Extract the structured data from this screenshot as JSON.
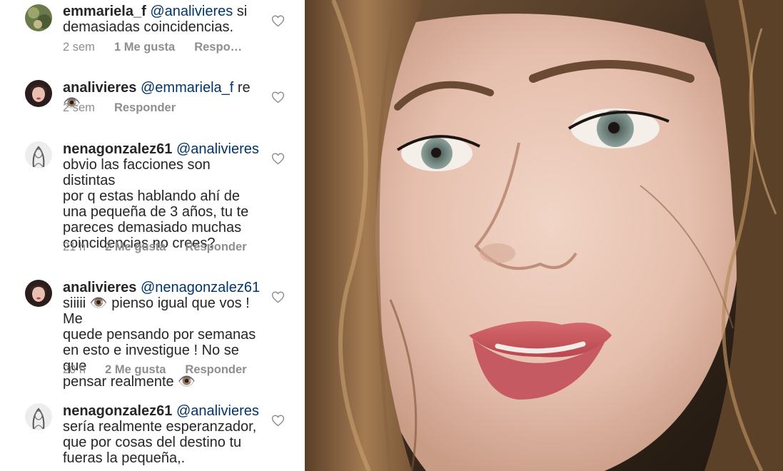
{
  "comments": [
    {
      "username": "emmariela_f",
      "mention": "@analivieres",
      "text": " si\ndemasiadas coincidencias.",
      "time": "2 sem",
      "likes": "1 Me gusta",
      "reply": "Respo…",
      "avatar": "green-avatar"
    },
    {
      "username": "analivieres",
      "mention": "@emmariela_f",
      "text": " re 👁️",
      "time": "2 sem",
      "likes": "",
      "reply": "Responder",
      "avatar": "woman-avatar"
    },
    {
      "username": "nenagonzalez61",
      "mention": "@analivieres",
      "text": "\nobvio las facciones son distintas\npor q estas hablando ahí de\nuna pequeña de 3 años, tu te\npareces demasiado muchas\ncoincidencias no crees?",
      "time": "21 h",
      "likes": "2 Me gusta",
      "reply": "Responder",
      "avatar": "sketch-avatar"
    },
    {
      "username": "analivieres",
      "mention": "@nenagonzalez61",
      "text": "\nsiiiii 👁️ pienso igual que vos ! Me\nquede pensando por semanas\nen esto e investigue ! No se que\npensar realmente 👁️",
      "time": "20 h",
      "likes": "2 Me gusta",
      "reply": "Responder",
      "avatar": "woman-avatar"
    },
    {
      "username": "nenagonzalez61",
      "mention": "@analivieres",
      "text": "\nsería realmente esperanzador,\nque por cosas del destino tu\nfueras la pequeña,.",
      "time": "",
      "likes": "",
      "reply": "",
      "avatar": "sketch-avatar"
    }
  ],
  "icons": {
    "like": "heart-outline-icon"
  },
  "colors": {
    "text": "#262626",
    "meta": "#8e8e8e",
    "mention": "#003569"
  }
}
